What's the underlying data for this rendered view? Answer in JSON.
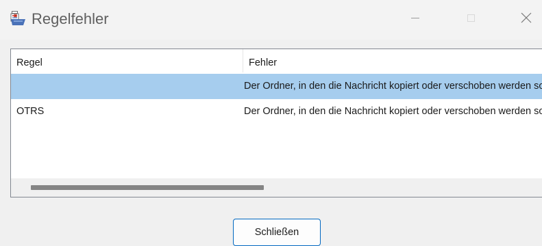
{
  "window": {
    "title": "Regelfehler",
    "app_icon": "rules-error-icon",
    "controls": {
      "minimize_icon": "minimize-icon",
      "maximize_icon": "maximize-icon",
      "close_icon": "close-icon"
    }
  },
  "list": {
    "columns": [
      "Regel",
      "Fehler"
    ],
    "rows": [
      {
        "regel": "",
        "fehler": "Der Ordner, in den die Nachricht kopiert oder verschoben werden soll",
        "selected": true
      },
      {
        "regel": "OTRS",
        "fehler": "Der Ordner, in den die Nachricht kopiert oder verschoben werden soll",
        "selected": false
      }
    ]
  },
  "footer": {
    "close_label": "Schließen"
  },
  "colors": {
    "selection": "#a6cdee",
    "button_border": "#0067c0",
    "background": "#f0f0f0"
  }
}
